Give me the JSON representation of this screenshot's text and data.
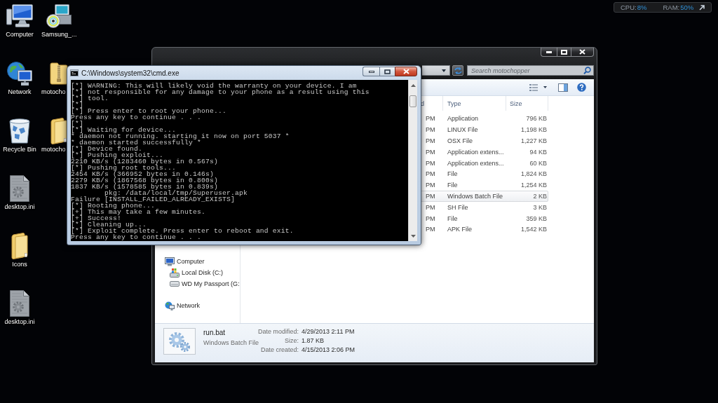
{
  "desktop": {
    "columns": [
      {
        "icons": [
          {
            "label": "Computer",
            "kind": "computer"
          },
          {
            "label": "Network",
            "kind": "network"
          },
          {
            "label": "Recycle Bin",
            "kind": "recycle-bin"
          },
          {
            "label": "desktop.ini",
            "kind": "settings-file"
          },
          {
            "label": "Icons",
            "kind": "folder"
          },
          {
            "label": "desktop.ini",
            "kind": "settings-file"
          }
        ]
      },
      {
        "icons": [
          {
            "label": "Samsung_...",
            "kind": "installer"
          },
          {
            "label": "motocho",
            "kind": "zip-folder"
          },
          {
            "label": "motocho",
            "kind": "folder"
          }
        ]
      }
    ]
  },
  "system_monitor": {
    "cpu_label": "CPU:",
    "cpu_value": "8%",
    "ram_label": "RAM:",
    "ram_value": "50%"
  },
  "explorer_window": {
    "search": {
      "placeholder": "Search motochopper"
    },
    "file_list": {
      "columns": [
        "d",
        "Type",
        "Size"
      ],
      "rows": [
        {
          "column_2": "PM",
          "type": "Application",
          "size": "796 KB",
          "selected": false
        },
        {
          "column_2": "PM",
          "type": "LINUX File",
          "size": "1,198 KB",
          "selected": false
        },
        {
          "column_2": "PM",
          "type": "OSX File",
          "size": "1,227 KB",
          "selected": false
        },
        {
          "column_2": "PM",
          "type": "Application extens...",
          "size": "94 KB",
          "selected": false
        },
        {
          "column_2": "PM",
          "type": "Application extens...",
          "size": "60 KB",
          "selected": false
        },
        {
          "column_2": "PM",
          "type": "File",
          "size": "1,824 KB",
          "selected": false
        },
        {
          "column_2": "PM",
          "type": "File",
          "size": "1,254 KB",
          "selected": false
        },
        {
          "column_2": "PM",
          "type": "Windows Batch File",
          "size": "2 KB",
          "selected": true
        },
        {
          "column_2": "PM",
          "type": "SH File",
          "size": "3 KB",
          "selected": false
        },
        {
          "column_2": "PM",
          "type": "File",
          "size": "359 KB",
          "selected": false
        },
        {
          "column_2": "PM",
          "type": "APK File",
          "size": "1,542 KB",
          "selected": false
        }
      ]
    },
    "navigation": {
      "items": [
        {
          "label": "Computer",
          "kind": "computer",
          "children": [
            {
              "label": "Local Disk (C:)",
              "kind": "system-drive"
            },
            {
              "label": "WD My Passport (G:",
              "kind": "external-drive"
            }
          ]
        },
        {
          "label": "Network",
          "kind": "network"
        }
      ]
    },
    "details": {
      "name": "run.bat",
      "type": "Windows Batch File",
      "properties": [
        {
          "label": "Date modified:",
          "value": "4/29/2013 2:11 PM"
        },
        {
          "label": "Size:",
          "value": "1.87 KB"
        },
        {
          "label": "Date created:",
          "value": "4/15/2013 2:06 PM"
        }
      ]
    }
  },
  "cmd_window": {
    "title": "C:\\Windows\\system32\\cmd.exe",
    "lines": [
      "[*] WARNING: This will likely void the warranty on your device. I am",
      "[*] not responsible for any damage to your phone as a result using this",
      "[*] tool.",
      "[*]",
      "[*] Press enter to root your phone...",
      "Press any key to continue . . .",
      "[*]",
      "[*] Waiting for device...",
      "* daemon not running. starting it now on port 5037 *",
      "* daemon started successfully *",
      "[*] Device found.",
      "[*] Pushing exploit...",
      "2210 KB/s (1283460 bytes in 0.567s)",
      "[*] Pushing root tools...",
      "2454 KB/s (366952 bytes in 0.146s)",
      "2279 KB/s (1867568 bytes in 0.800s)",
      "1837 KB/s (1578585 bytes in 0.839s)",
      "        pkg: /data/local/tmp/Superuser.apk",
      "Failure [INSTALL_FAILED_ALREADY_EXISTS]",
      "[*] Rooting phone...",
      "[+] This may take a few minutes.",
      "[+] Success!",
      "[*] Cleaning up...",
      "[*] Exploit complete. Press enter to reboot and exit.",
      "Press any key to continue . . ."
    ]
  }
}
